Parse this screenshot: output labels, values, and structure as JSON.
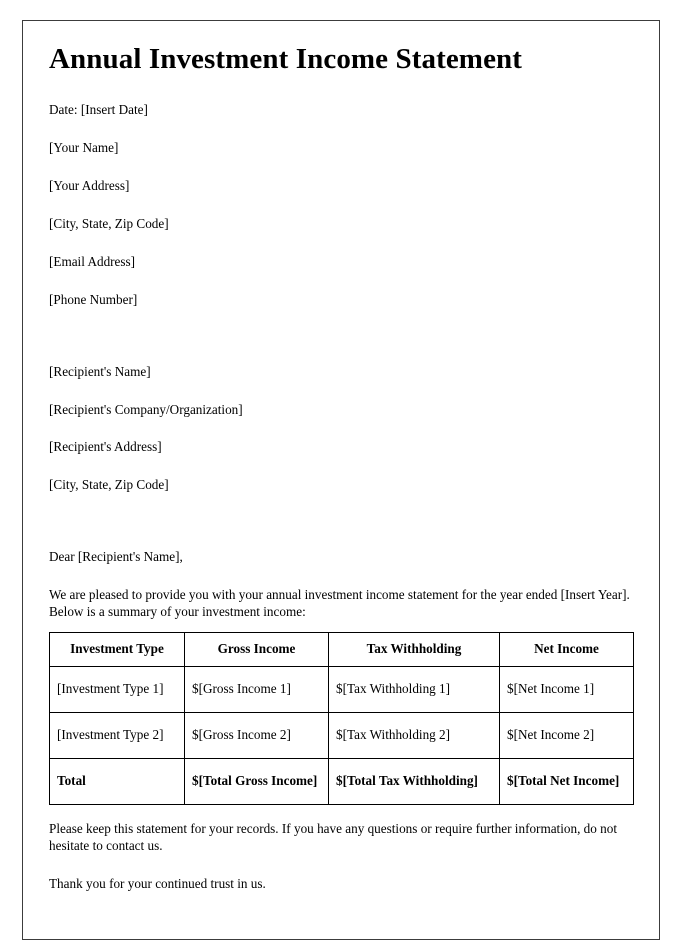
{
  "document": {
    "title": "Annual Investment Income Statement",
    "date_line": "Date: [Insert Date]",
    "sender": {
      "name": "[Your Name]",
      "address": "[Your Address]",
      "city_state_zip": "[City, State, Zip Code]",
      "email": "[Email Address]",
      "phone": "[Phone Number]"
    },
    "recipient": {
      "name": "[Recipient's Name]",
      "company": "[Recipient's Company/Organization]",
      "address": "[Recipient's Address]",
      "city_state_zip": "[City, State, Zip Code]"
    },
    "salutation": "Dear [Recipient's Name],",
    "intro_paragraph": "We are pleased to provide you with your annual investment income statement for the year ended [Insert Year]. Below is a summary of your investment income:",
    "table": {
      "headers": [
        "Investment Type",
        "Gross Income",
        "Tax Withholding",
        "Net Income"
      ],
      "rows": [
        {
          "type": "[Investment Type 1]",
          "gross": "$[Gross Income 1]",
          "tax": "$[Tax Withholding 1]",
          "net": "$[Net Income 1]"
        },
        {
          "type": "[Investment Type 2]",
          "gross": "$[Gross Income 2]",
          "tax": "$[Tax Withholding 2]",
          "net": "$[Net Income 2]"
        }
      ],
      "total_row": {
        "label": "Total",
        "gross": "$[Total Gross Income]",
        "tax": "$[Total Tax Withholding]",
        "net": "$[Total Net Income]"
      }
    },
    "closing_paragraph": "Please keep this statement for your records. If you have any questions or require further information, do not hesitate to contact us.",
    "thanks_paragraph": "Thank you for your continued trust in us."
  },
  "style": {
    "page_border_color": "#3c3c3c",
    "text_color": "#000000",
    "table_border_color": "#000000",
    "background_color": "#ffffff"
  }
}
